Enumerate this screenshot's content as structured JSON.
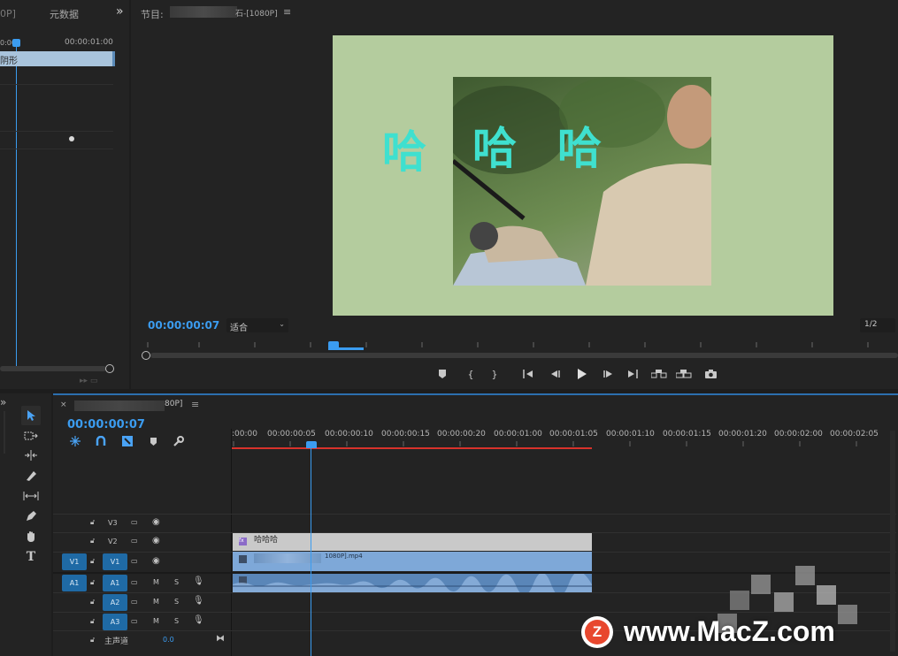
{
  "source_panel": {
    "tab_partial": "0P]",
    "tab_metadata": "元数据",
    "more": "»",
    "timecode_right": "00:00:01:00",
    "clip_label": "阴形"
  },
  "program": {
    "title_prefix": "节目:",
    "title_suffix": "[1080P]",
    "menu": "≡",
    "timecode": "00:00:00:07",
    "fit_label": "适合",
    "resolution": "1/2",
    "overlay_text": [
      "哈",
      "哈",
      "哈"
    ]
  },
  "timeline": {
    "tab_close": "×",
    "tab_suffix": "80P]",
    "menu": "≡",
    "timecode": "00:00:00:07",
    "ruler": [
      ":00:00",
      "00:00:00:05",
      "00:00:00:10",
      "00:00:00:15",
      "00:00:00:20",
      "00:00:01:00",
      "00:00:01:05",
      "00:00:01:10",
      "00:00:01:15",
      "00:00:01:20",
      "00:00:02:00",
      "00:00:02:05"
    ],
    "tracks": {
      "v3": "V3",
      "v2": "V2",
      "v1_src": "V1",
      "v1": "V1",
      "a1_src": "A1",
      "a1": "A1",
      "a2": "A2",
      "a3": "A3",
      "m": "M",
      "s": "S"
    },
    "master_label": "主声道",
    "master_value": "0.0",
    "clip_title": "哈哈哈",
    "clip_video": "1080P].mp4",
    "clip_fx": "fx"
  },
  "watermark": {
    "logo_letter": "Z",
    "text": "www.MacZ.com"
  },
  "colors": {
    "accent": "#3b9cf0",
    "video_clip": "#7ea8d8",
    "title_clip": "#c9c9c9",
    "program_bg": "#b4cc9e",
    "text_cyan": "#3fe0cf",
    "render_bar": "#d8322b",
    "watermark_logo": "#e8472e"
  },
  "icons": [
    "select-icon",
    "track-select-icon",
    "ripple-icon",
    "razor-icon",
    "slip-icon",
    "pen-icon",
    "hand-icon",
    "type-icon",
    "play-icon",
    "step-back-icon",
    "step-forward-icon",
    "camera-icon",
    "eye-icon",
    "mic-icon",
    "lock-icon",
    "marker-icon",
    "wrench-icon"
  ]
}
